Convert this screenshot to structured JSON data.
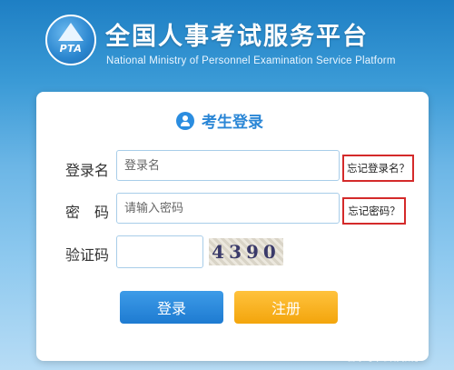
{
  "header": {
    "logo_text": "PTA",
    "title_cn": "全国人事考试服务平台",
    "title_en": "National Ministry of Personnel Examination Service Platform"
  },
  "login": {
    "title": "考生登录",
    "username_label": "登录名",
    "username_placeholder": "登录名",
    "forgot_username": "忘记登录名？",
    "password_label": "密　码",
    "password_placeholder": "请输入密码",
    "forgot_password": "忘记密码？",
    "captcha_label": "验证码",
    "captcha_value": "",
    "captcha_text": "4390",
    "login_button": "登录",
    "register_button": "注册"
  },
  "watermark": "百家号 / 云彩教育",
  "icons": {
    "logo": "pta-logo-icon",
    "user": "user-icon"
  },
  "colors": {
    "accent_blue": "#2a86d6",
    "login_button": "#1e7bd1",
    "register_button": "#f3a50c",
    "highlight_border": "#d42a2a"
  }
}
